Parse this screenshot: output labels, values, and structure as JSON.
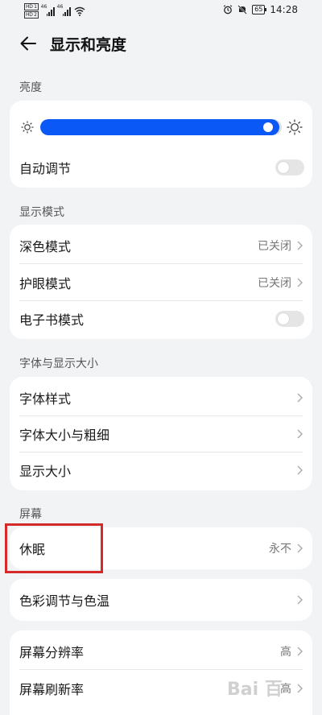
{
  "status_bar": {
    "hd1": "HD 1",
    "hd2": "HD 2",
    "net1": "46",
    "net2": "46",
    "battery": "65",
    "time": "14:28"
  },
  "header": {
    "title": "显示和亮度"
  },
  "brightness": {
    "section_title": "亮度",
    "level": 0.97,
    "auto_label": "自动调节",
    "auto_on": false
  },
  "display_mode": {
    "section_title": "显示模式",
    "dark_label": "深色模式",
    "dark_value": "已关闭",
    "eye_label": "护眼模式",
    "eye_value": "已关闭",
    "ebook_label": "电子书模式",
    "ebook_on": false
  },
  "font_size": {
    "section_title": "字体与显示大小",
    "font_style": "字体样式",
    "font_size_weight": "字体大小与粗细",
    "display_size": "显示大小"
  },
  "screen": {
    "section_title": "屏幕",
    "sleep_label": "休眠",
    "sleep_value": "永不",
    "color_label": "色彩调节与色温",
    "resolution_label": "屏幕分辨率",
    "resolution_value": "高",
    "refresh_label": "屏幕刷新率",
    "refresh_value": "高"
  },
  "colors": {
    "accent": "#0a59f7",
    "highlight": "#d42a2a",
    "background": "#f1f3f5"
  }
}
